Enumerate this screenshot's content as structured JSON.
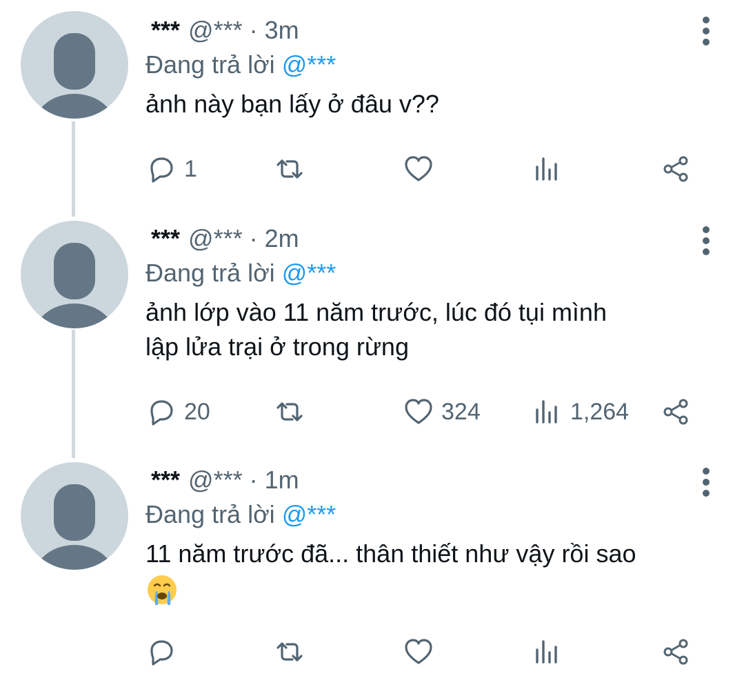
{
  "tweets": [
    {
      "name": "***",
      "handle": "@***",
      "time": "· 3m",
      "replying_prefix": "Đang trả lời",
      "replying_to": "@***",
      "text": "ảnh này bạn lấy ở đâu v??",
      "reply_count": "1",
      "retweet_count": "",
      "like_count": "",
      "view_count": ""
    },
    {
      "name": "***",
      "handle": "@***",
      "time": "· 2m",
      "replying_prefix": "Đang trả lời",
      "replying_to": "@***",
      "text": "ảnh lớp vào 11 năm trước, lúc đó tụi mình\nlập lửa trại ở trong rừng",
      "reply_count": "20",
      "retweet_count": "",
      "like_count": "324",
      "view_count": "1,264"
    },
    {
      "name": "***",
      "handle": "@***",
      "time": "· 1m",
      "replying_prefix": "Đang trả lời",
      "replying_to": "@***",
      "text": "11 năm trước đã... thân thiết như vậy rồi sao",
      "emoji": "loudly-crying-face",
      "reply_count": "",
      "retweet_count": "",
      "like_count": "",
      "view_count": ""
    }
  ],
  "colors": {
    "secondary_text": "#536471",
    "mention": "#1d9bf0",
    "avatar_bg": "#ccd6dd",
    "avatar_fg": "#657786",
    "thread_line": "#cfd9de"
  }
}
